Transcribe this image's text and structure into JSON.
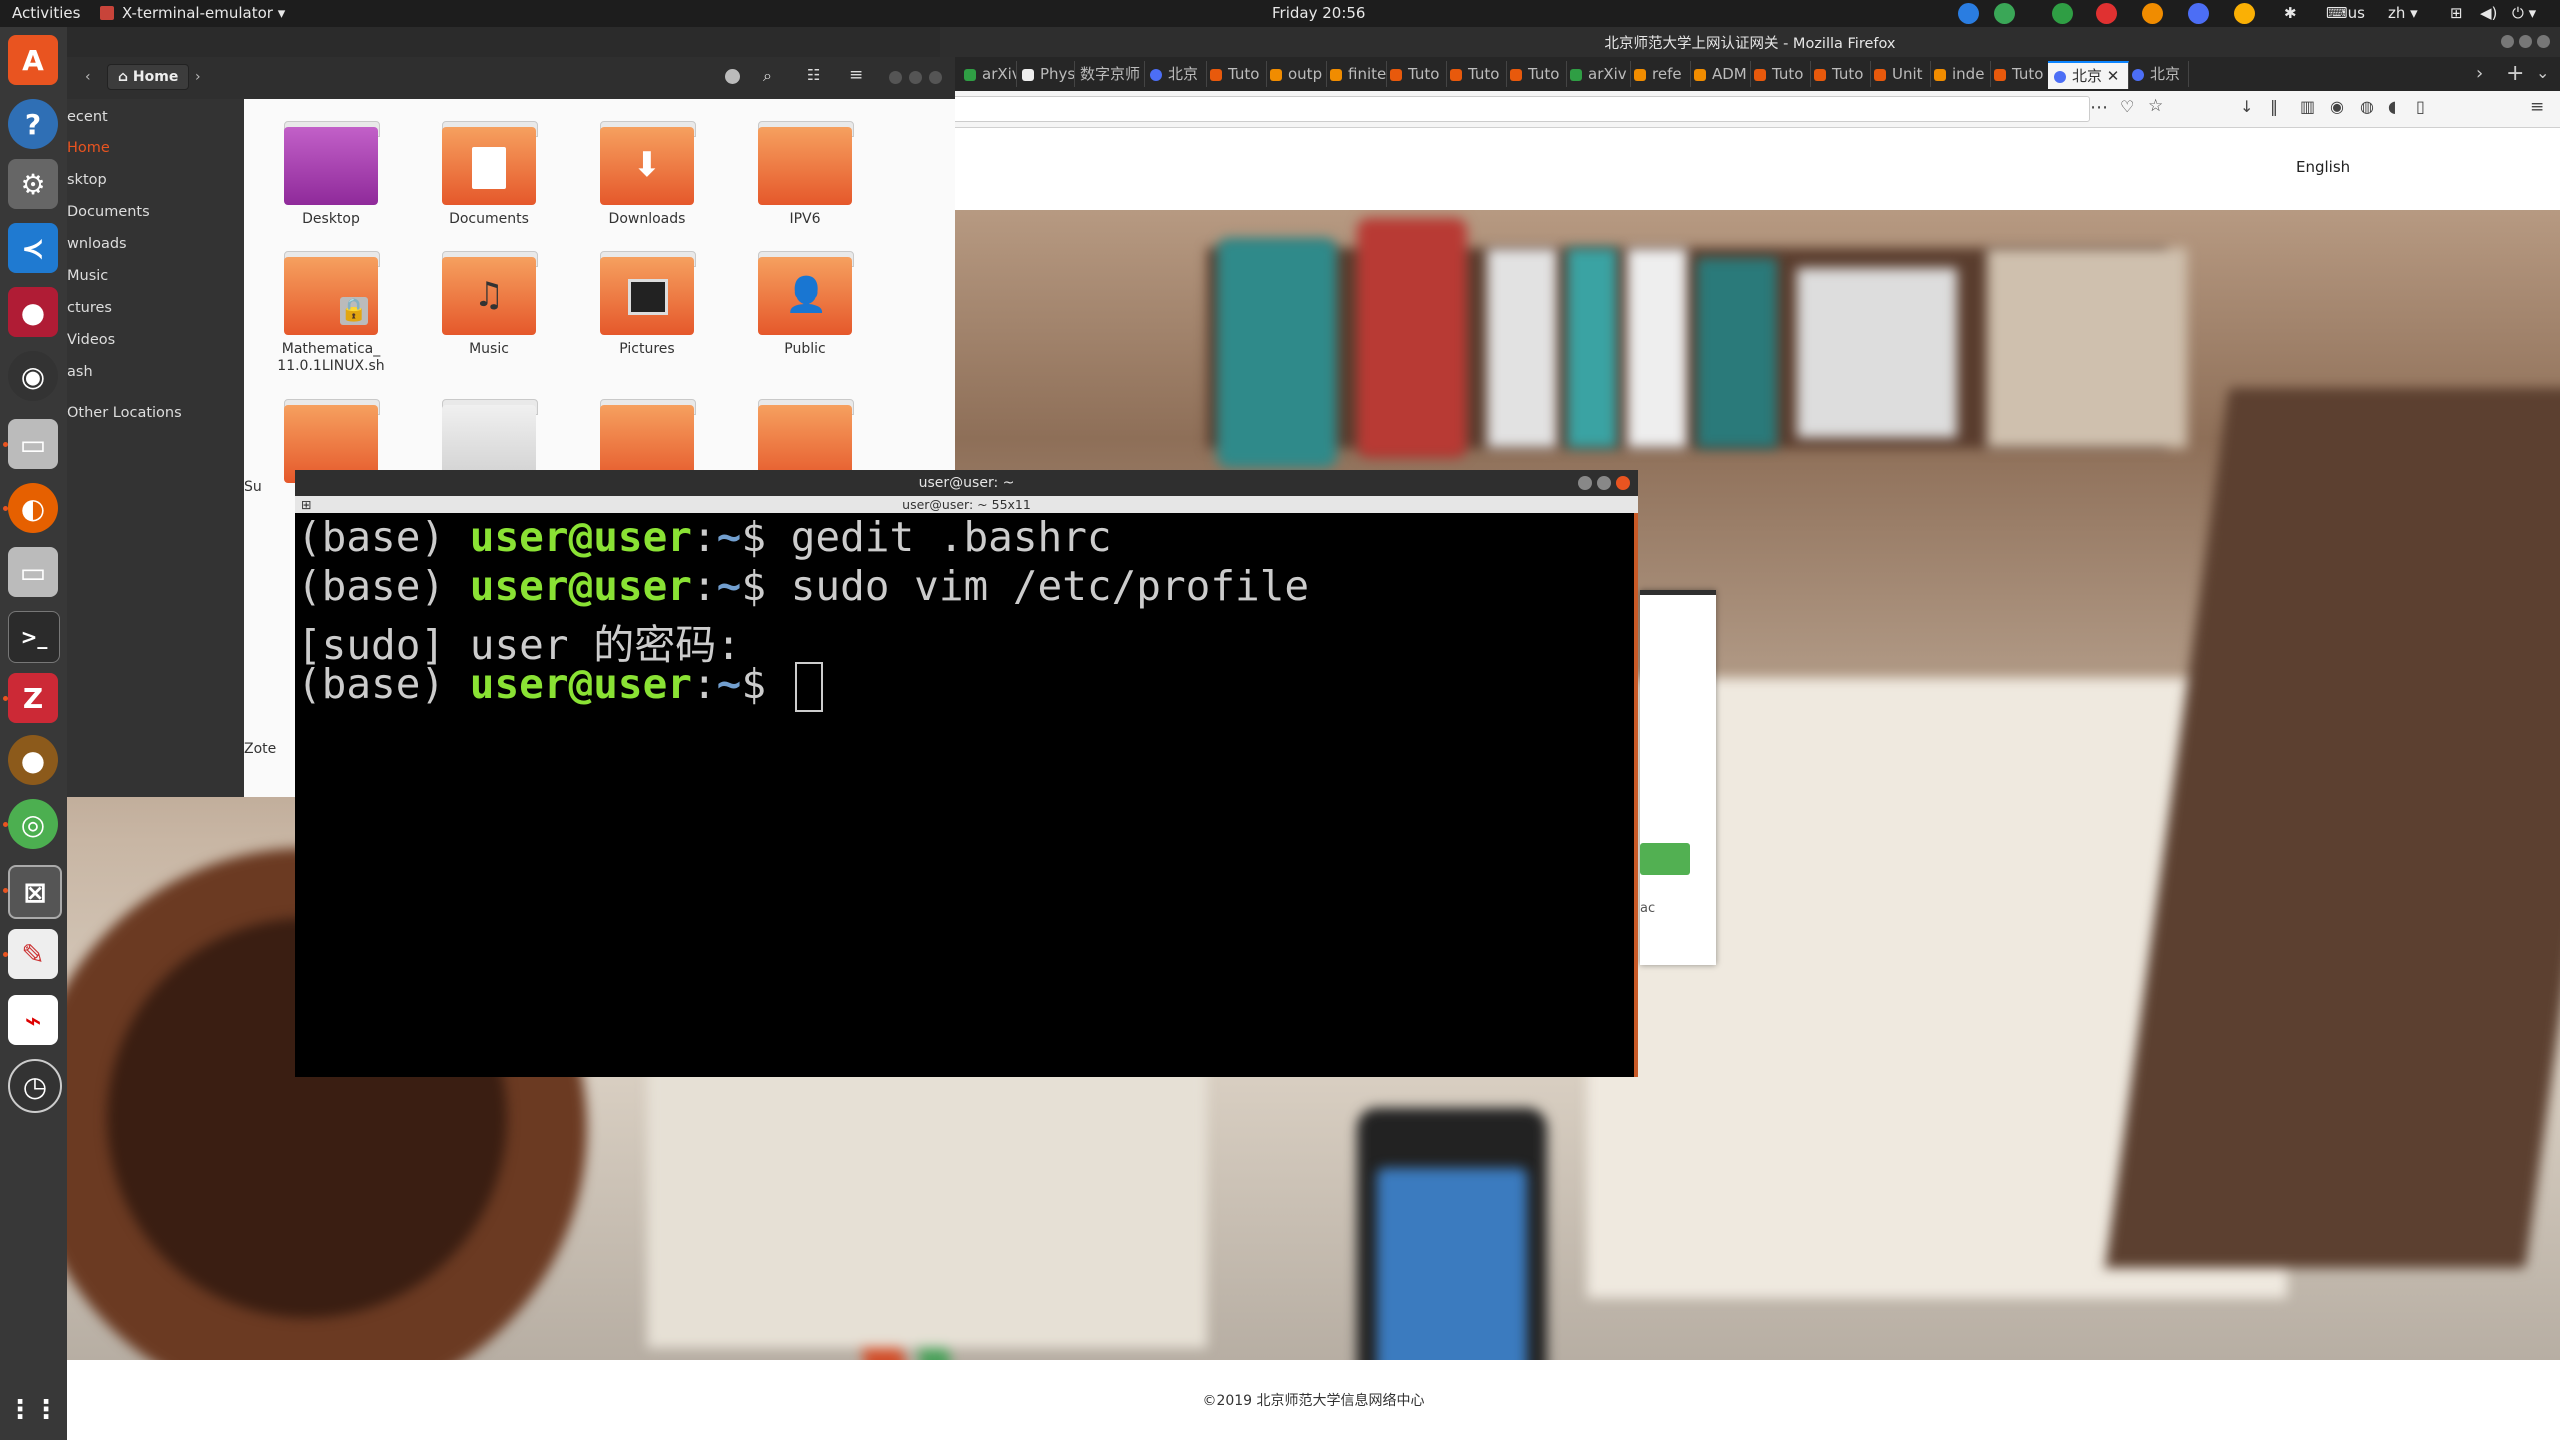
{
  "topbar": {
    "activities": "Activities",
    "app_menu": "X-terminal-emulator",
    "clock": "Friday 20:56",
    "keyboard": "us",
    "lang": "zh"
  },
  "firefox": {
    "window_title": "北京师范大学上网认证网关 - Mozilla Firefox",
    "tabs": [
      "arXiv",
      "Phys",
      "数字京师",
      "北京",
      "Tuto",
      "outp",
      "finite",
      "Tuto",
      "Tuto",
      "Tuto",
      "arXiv",
      "refe",
      "ADM",
      "Tuto",
      "Tuto",
      "Unit",
      "inde",
      "Tuto",
      "北京",
      "北京"
    ],
    "url_fragment": "",
    "language_link": "English",
    "footer": "©2019 北京师范大学信息网络中心",
    "button_fragment": "ac"
  },
  "files": {
    "location": "Home",
    "sidebar": [
      "ecent",
      "Home",
      "sktop",
      "Documents",
      "wnloads",
      "Music",
      "ctures",
      "Videos",
      "ash",
      "Other Locations"
    ],
    "folders": [
      "Desktop",
      "Documents",
      "Downloads",
      "IPV6",
      "Mathematica_ 11.0.1LINUX.sh",
      "Music",
      "Pictures",
      "Public"
    ],
    "partial_labels": [
      "Su",
      "Zote"
    ]
  },
  "terminal": {
    "title": "user@user: ~",
    "subtitle": "user@user: ~ 55x11",
    "lines": [
      {
        "prefix": "(base) ",
        "user": "user@user",
        "sep": ":",
        "path": "~",
        "cmd": "$ gedit .bashrc"
      },
      {
        "prefix": "(base) ",
        "user": "user@user",
        "sep": ":",
        "path": "~",
        "cmd": "$ sudo vim /etc/profile"
      },
      {
        "plain": "[sudo] user 的密码:"
      },
      {
        "prefix": "(base) ",
        "user": "user@user",
        "sep": ":",
        "path": "~",
        "cmd": "$ "
      }
    ]
  },
  "colors": {
    "accent": "#e95420",
    "prompt_user": "#8ae234",
    "prompt_path": "#729fcf"
  }
}
